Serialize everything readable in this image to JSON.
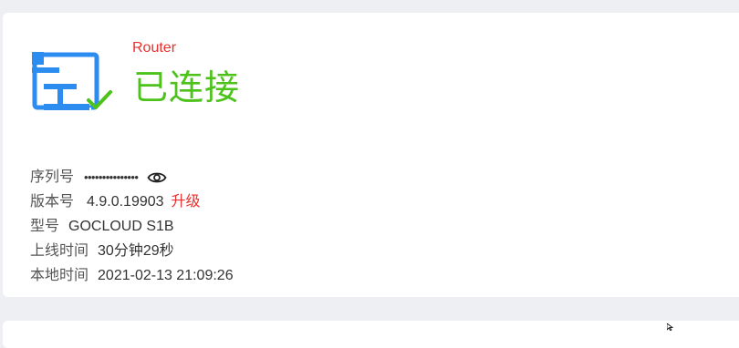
{
  "device": {
    "name": "Router",
    "status": "已连接",
    "colors": {
      "icon": "#2d8cf0",
      "check": "#4cc21a",
      "status": "#4cc21a",
      "name": "#e8312f",
      "upgrade": "#e8312f"
    }
  },
  "info": {
    "serial_label": "序列号",
    "serial_value": "•••••••••••••••",
    "serial_icon": "eye-icon",
    "version_label": "版本号",
    "version_value": "4.9.0.19903",
    "upgrade_label": "升级",
    "model_label": "型号",
    "model_value": "GOCLOUD S1B",
    "uptime_label": "上线时间",
    "uptime_value": "30分钟29秒",
    "local_time_label": "本地时间",
    "local_time_value": "2021-02-13 21:09:26"
  }
}
